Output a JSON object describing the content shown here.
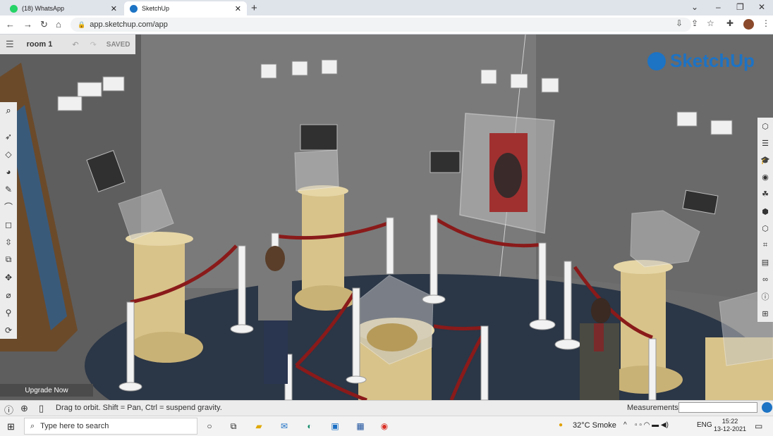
{
  "browser": {
    "tabs": [
      {
        "label": "(18) WhatsApp",
        "icon": "whatsapp-icon",
        "active": false
      },
      {
        "label": "SketchUp",
        "icon": "sketchup-icon",
        "active": true
      }
    ],
    "url": "app.sketchup.com/app"
  },
  "app": {
    "title": "room 1",
    "saved_label": "SAVED",
    "logo_text": "SketchUp",
    "upgrade_label": "Upgrade Now",
    "left_tools": [
      "search-icon",
      "select-icon",
      "eraser-icon",
      "paint-bucket-icon",
      "pencil-icon",
      "arc-icon",
      "rectangle-icon",
      "push-pull-icon",
      "offset-icon",
      "move-icon",
      "rotate-icon",
      "tape-measure-icon",
      "orbit-icon"
    ],
    "right_tools": [
      "entity-info-icon",
      "instructor-icon",
      "components-icon",
      "materials-icon",
      "styles-icon",
      "layers-icon",
      "scenes-icon",
      "solid-tools-icon",
      "outliner-icon",
      "display-icon",
      "info-icon",
      "extension-icon"
    ]
  },
  "status": {
    "hint": "Drag to orbit. Shift = Pan, Ctrl = suspend gravity.",
    "measurements_label": "Measurements",
    "measurements_value": ""
  },
  "taskbar": {
    "search_placeholder": "Type here to search",
    "weather": "32°C Smoke",
    "language": "ENG",
    "time": "15:22",
    "date": "13-12-2021"
  },
  "colors": {
    "sketchup_blue": "#1d73c4",
    "rope_red": "#8a1a1a",
    "pedestal": "#d8c38a",
    "floor": "#2b3646"
  }
}
